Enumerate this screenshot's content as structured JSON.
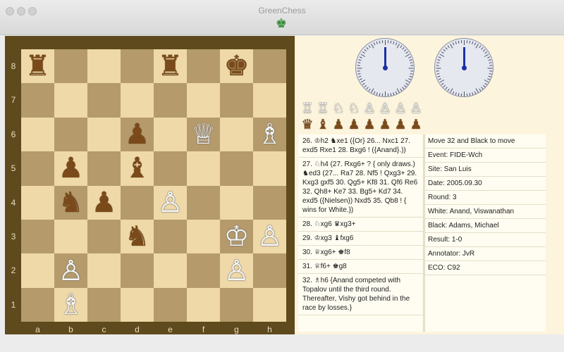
{
  "window": {
    "title": "GreenChess"
  },
  "toolbar": {
    "icon": "green-chess-king-icon"
  },
  "board": {
    "ranks": [
      "8",
      "7",
      "6",
      "5",
      "4",
      "3",
      "2",
      "1"
    ],
    "files": [
      "a",
      "b",
      "c",
      "d",
      "e",
      "f",
      "g",
      "h"
    ],
    "rows": [
      [
        "♜",
        "",
        "",
        "",
        "♜",
        "",
        "♚",
        ""
      ],
      [
        "",
        "",
        "",
        "",
        "",
        "",
        "",
        ""
      ],
      [
        "",
        "",
        "",
        "♟",
        "",
        "♕",
        "",
        "♗"
      ],
      [
        "",
        "♟",
        "",
        "♝",
        "",
        "",
        "",
        ""
      ],
      [
        "",
        "♞",
        "♟",
        "",
        "♙",
        "",
        "",
        ""
      ],
      [
        "",
        "",
        "",
        "♞",
        "",
        "",
        "♔",
        "♙"
      ],
      [
        "",
        "♙",
        "",
        "",
        "",
        "",
        "♙",
        ""
      ],
      [
        "",
        "♗",
        "",
        "",
        "",
        "",
        "",
        ""
      ]
    ],
    "colors": [
      [
        "b",
        "",
        "",
        "",
        "b",
        "",
        "b",
        ""
      ],
      [
        "",
        "",
        "",
        "",
        "",
        "",
        "",
        ""
      ],
      [
        "",
        "",
        "",
        "b",
        "",
        "w",
        "",
        "w"
      ],
      [
        "",
        "b",
        "",
        "b",
        "",
        "",
        "",
        ""
      ],
      [
        "",
        "b",
        "b",
        "",
        "w",
        "",
        "",
        ""
      ],
      [
        "",
        "",
        "",
        "b",
        "",
        "",
        "w",
        "w"
      ],
      [
        "",
        "w",
        "",
        "",
        "",
        "",
        "w",
        ""
      ],
      [
        "",
        "w",
        "",
        "",
        "",
        "",
        "",
        ""
      ]
    ]
  },
  "clocks": {
    "white_icon": "analog-clock-icon",
    "black_icon": "analog-clock-icon"
  },
  "captured": {
    "white_pieces": [
      "♖",
      "♖",
      "♘",
      "♘",
      "♙",
      "♙",
      "♙",
      "♙"
    ],
    "black_pieces": [
      "♛",
      "♝",
      "♟",
      "♟",
      "♟",
      "♟",
      "♟",
      "♟"
    ]
  },
  "moves": [
    "26. ♔h2 ♞xe1 ({Or} 26... Nxc1 27. exd5 Rxe1 28. Bxg6 ! ({Anand}.))",
    "27. ♘h4 (27. Rxg6+ ? { only draws.) ♞ed3 (27... Ra7 28. Nf5 ! Qxg3+ 29. Kxg3 gxf5 30. Qg5+ Kf8 31. Qf6 Re6 32. Qh8+ Ke7 33. Bg5+ Kd7 34. exd5 ({Nielsen}) Nxd5 35. Qb8 ! { wins for White.})",
    "28. ♘xg6 ♛xg3+",
    "29. ♔xg3 ♝fxg6",
    "30. ♕xg6+ ♚f8",
    "31. ♕f6+ ♚g8",
    "32. ♗h6 {Anand competed with Topalov until the third round. Thereafter, Vishy got behind in the race by losses.}"
  ],
  "info": {
    "status": "Move 32 and Black to move",
    "event": "Event:  FIDE-Wch",
    "site": "Site:  San Luis",
    "date": "Date:  2005.09.30",
    "round": "Round:  3",
    "white": "White:  Anand, Viswanathan",
    "black": "Black:  Adams, Michael",
    "result": "Result:  1-0",
    "annotator": "Annotator:  JvR",
    "eco": "ECO:  C92"
  }
}
